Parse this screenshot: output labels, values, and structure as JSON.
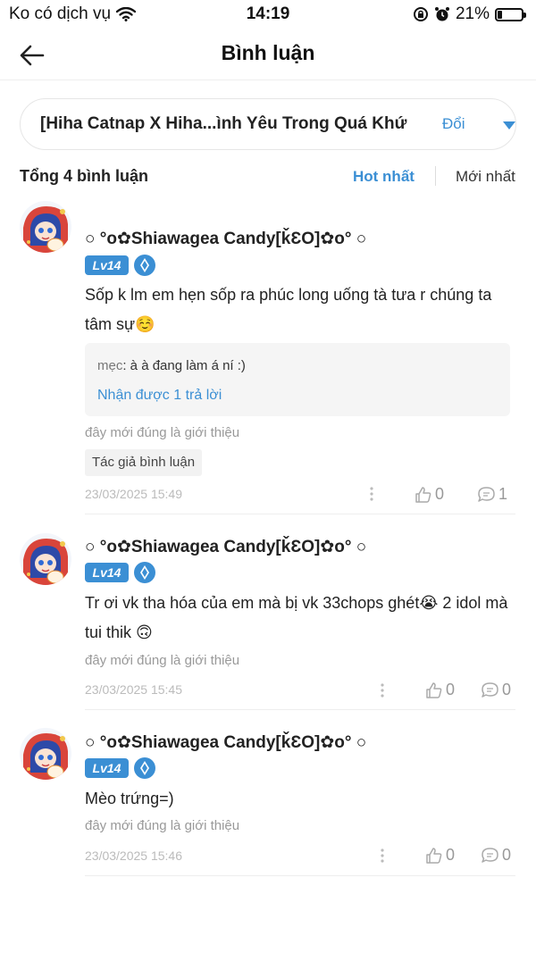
{
  "status_bar": {
    "carrier": "Ko có dịch vụ",
    "time": "14:19",
    "battery": "21%",
    "battery_level": 0.21,
    "icons": [
      "wifi-icon",
      "orientation-lock-icon",
      "alarm-icon",
      "battery-icon"
    ]
  },
  "nav": {
    "title": "Bình luận",
    "back_icon": "back-arrow-icon"
  },
  "work_selector": {
    "title": "[Hiha Catnap X Hiha...ình Yêu Trong Quá Khứ",
    "change_label": "Đổi",
    "caret_icon": "caret-down-icon"
  },
  "summary": {
    "count_label": "Tổng 4 bình luận",
    "sort_hot": "Hot nhất",
    "sort_new": "Mới nhất"
  },
  "colors": {
    "accent": "#3b8fd4",
    "muted": "#999999",
    "divider": "#eeeeee"
  },
  "comments": [
    {
      "username": "○ °o✿Shiawagea Candy[ǩƐO]✿o° ○",
      "level": "Lv14",
      "text": "Sốp k lm em hẹn sốp ra phúc long uống tà tưa r chúng ta tâm sự☺️",
      "reply": {
        "author": "mẹc",
        "text": ": à à đang làm á ní :)",
        "more_label": "Nhận được 1 trả lời"
      },
      "source_note": "đây mới đúng là giới thiệu",
      "author_tag": "Tác giả bình luận",
      "date": "23/03/2025 15:49",
      "likes": "0",
      "replies": "1"
    },
    {
      "username": "○ °o✿Shiawagea Candy[ǩƐO]✿o° ○",
      "level": "Lv14",
      "text": "Tr ơi vk tha hóa của em mà bị vk 33chops ghét😭 2 idol mà tui thik 🙃",
      "source_note": "đây mới đúng là giới thiệu",
      "date": "23/03/2025 15:45",
      "likes": "0",
      "replies": "0"
    },
    {
      "username": "○ °o✿Shiawagea Candy[ǩƐO]✿o° ○",
      "level": "Lv14",
      "text": "Mèo trứng=)",
      "source_note": "đây mới đúng là giới thiệu",
      "date": "23/03/2025 15:46",
      "likes": "0",
      "replies": "0"
    }
  ]
}
